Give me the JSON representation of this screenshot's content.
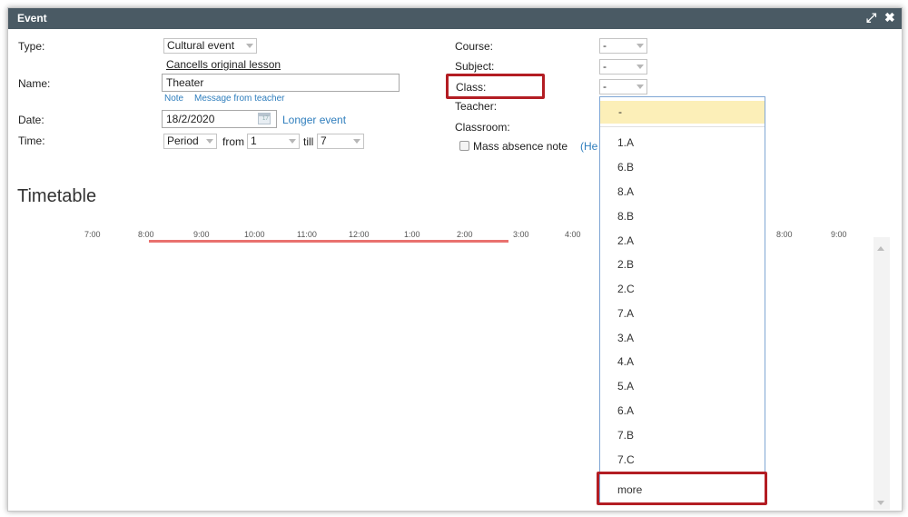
{
  "window": {
    "title": "Event",
    "expand_icon": "resize-icon",
    "close_icon": "close-icon"
  },
  "form": {
    "type_label": "Type:",
    "type_value": "Cultural event",
    "cancels_link": "Cancells original lesson",
    "name_label": "Name:",
    "name_value": "Theater",
    "note_link": "Note",
    "message_link": "Message from teacher",
    "date_label": "Date:",
    "date_value": "18/2/2020",
    "longer_event": "Longer event",
    "time_label": "Time:",
    "time_mode": "Period",
    "from_label": "from",
    "from_value": "1",
    "till_label": "till",
    "till_value": "7"
  },
  "right": {
    "course_label": "Course:",
    "course_value": "-",
    "subject_label": "Subject:",
    "subject_value": "-",
    "class_label": "Class:",
    "class_value": "-",
    "teacher_label": "Teacher:",
    "classroom_label": "Classroom:",
    "mass_absence": "Mass absence note",
    "help_link": "(He"
  },
  "timetable": {
    "heading": "Timetable",
    "ticks": [
      "7:00",
      "8:00",
      "9:00",
      "10:00",
      "11:00",
      "12:00",
      "1:00",
      "2:00",
      "3:00",
      "4:00",
      "8:00",
      "9:00"
    ]
  },
  "dropdown": {
    "selected": "-",
    "items": [
      "1.A",
      "6.B",
      "8.A",
      "8.B",
      "2.A",
      "2.B",
      "2.C",
      "7.A",
      "3.A",
      "4.A",
      "5.A",
      "6.A",
      "7.B",
      "7.C"
    ],
    "more": "more"
  },
  "colors": {
    "titlebar": "#4a5a64",
    "link": "#2f7ebd",
    "highlight": "#b31d23",
    "timeline": "#e9716e",
    "selected": "#fcefb8"
  }
}
